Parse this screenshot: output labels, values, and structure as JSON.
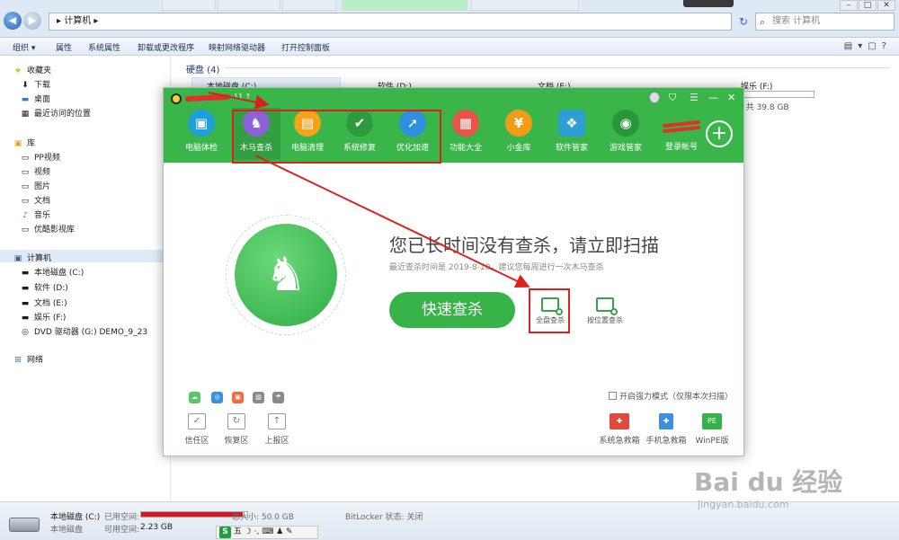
{
  "explorer": {
    "address_path": "▸ 计算机 ▸",
    "search_placeholder": "搜索 计算机",
    "window_buttons": [
      "–",
      "□",
      "✕"
    ],
    "toolbar": [
      "组织 ▾",
      "属性",
      "系统属性",
      "卸载或更改程序",
      "映射网络驱动器",
      "打开控制面板"
    ],
    "sidebar": {
      "favorites": {
        "label": "收藏夹",
        "items": [
          "下载",
          "桌面",
          "最近访问的位置"
        ]
      },
      "library": {
        "label": "库",
        "items": [
          "PP视频",
          "视频",
          "图片",
          "文档",
          "音乐",
          "优酷影视库"
        ]
      },
      "computer": {
        "label": "计算机",
        "items": [
          "本地磁盘 (C:)",
          "软件 (D:)",
          "文档 (E:)",
          "娱乐 (F:)",
          "DVD 驱动器 (G:) DEMO_9_23"
        ]
      },
      "network": {
        "label": "网络"
      }
    },
    "group_header": "硬盘 (4)",
    "drives": [
      "本地磁盘 (C:)",
      "软件 (D:)",
      "文档 (E:)",
      "娱乐 (F:)"
    ],
    "drive_f_free_text": ", 共 39.8 GB",
    "drive_f_used_fraction": 0.0,
    "status": {
      "drive_name": "本地磁盘 (C:)",
      "drive_type": "本地磁盘",
      "used_label": "已用空间:",
      "free_label": "可用空间:",
      "free_value": "2.23 GB",
      "total_label": "总大小: 50.0 GB",
      "bitlocker": "BitLocker 状态: 关闭",
      "used_fraction": 0.96
    },
    "ime": {
      "logo": "S",
      "text": "五 ☽ ·, ⌨ ♟ ✎"
    }
  },
  "manager": {
    "version_text": "11 ↑",
    "header_controls": [
      "⛉",
      "☰",
      "—",
      "✕"
    ],
    "tabs": [
      {
        "label": "电脑体检",
        "glyph": "▣",
        "color": "#1e9fd8"
      },
      {
        "label": "木马查杀",
        "glyph": "♞",
        "color": "#8b63d6"
      },
      {
        "label": "电脑清理",
        "glyph": "▤",
        "color": "#f5a21c"
      },
      {
        "label": "系统修复",
        "glyph": "✔",
        "color": "#2e9a3e"
      },
      {
        "label": "优化加速",
        "glyph": "➚",
        "color": "#2e8fe0"
      },
      {
        "label": "功能大全",
        "glyph": "▦",
        "color": "#e9544a"
      },
      {
        "label": "小金库",
        "glyph": "¥",
        "color": "#f29b16"
      },
      {
        "label": "软件管家",
        "glyph": "❖",
        "color": "#2d9fd5"
      },
      {
        "label": "游戏管家",
        "glyph": "◉",
        "color": "#27973a"
      }
    ],
    "login_label": "登录帐号",
    "plus_glyph": "+",
    "horse_glyph": "♞",
    "main_message": "您已长时间没有查杀，请立即扫描",
    "sub_message": "最近查杀时间是 2019-8-10，建议您每周进行一次木马查杀",
    "quick_scan": "快速查杀",
    "scan_options": [
      "全盘查杀",
      "按位置查杀"
    ],
    "force_mode": "开启强力模式（仅限本次扫描）",
    "mini_icons": [
      {
        "glyph": "☁",
        "color": "#5cc46a"
      },
      {
        "glyph": "◎",
        "color": "#3b8ee0"
      },
      {
        "glyph": "▣",
        "color": "#ef6b3a"
      },
      {
        "glyph": "▨",
        "color": "#8a8a8a"
      },
      {
        "glyph": "☂",
        "color": "#8a8a8a"
      }
    ],
    "bottom_tools": [
      {
        "label": "信任区",
        "glyph": "✓"
      },
      {
        "label": "恢复区",
        "glyph": "↻"
      },
      {
        "label": "上报区",
        "glyph": "↑"
      }
    ],
    "rescue_tools": [
      {
        "label": "系统急救箱",
        "glyph": "✚",
        "color": "#e04a3c"
      },
      {
        "label": "手机急救箱",
        "glyph": "✚",
        "color": "#3d8fe0"
      },
      {
        "label": "WinPE版",
        "glyph": "PE",
        "color": "#36b24a"
      }
    ]
  },
  "watermark": {
    "brand": "Bai du 经验",
    "site": "jingyan.baidu.com"
  }
}
